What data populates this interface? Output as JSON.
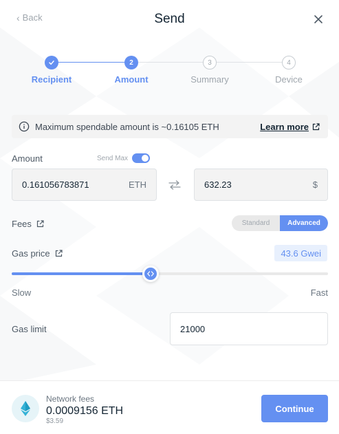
{
  "header": {
    "back_label": "Back",
    "title": "Send"
  },
  "stepper": {
    "steps": [
      {
        "number": "",
        "label": "Recipient",
        "state": "done"
      },
      {
        "number": "2",
        "label": "Amount",
        "state": "active"
      },
      {
        "number": "3",
        "label": "Summary",
        "state": "todo"
      },
      {
        "number": "4",
        "label": "Device",
        "state": "todo"
      }
    ]
  },
  "info": {
    "message": "Maximum spendable amount is ~0.16105 ETH",
    "link": "Learn more"
  },
  "amount": {
    "label": "Amount",
    "send_max_label": "Send Max",
    "send_max_on": true,
    "crypto_value": "0.161056783871",
    "crypto_unit": "ETH",
    "fiat_value": "632.23",
    "fiat_unit": "$"
  },
  "fees": {
    "label": "Fees",
    "modes": [
      "Standard",
      "Advanced"
    ],
    "selected_mode": "Advanced"
  },
  "gas_price": {
    "label": "Gas price",
    "value": "43.6 Gwei",
    "slider_fraction": 0.44,
    "slow_label": "Slow",
    "fast_label": "Fast"
  },
  "gas_limit": {
    "label": "Gas limit",
    "value": "21000"
  },
  "footer": {
    "network_fees_label": "Network fees",
    "network_fees_value": "0.0009156 ETH",
    "network_fees_usd": "$3.59",
    "continue_label": "Continue"
  },
  "colors": {
    "accent": "#6490f1",
    "text": "#142533",
    "muted": "#a0a7ae"
  }
}
